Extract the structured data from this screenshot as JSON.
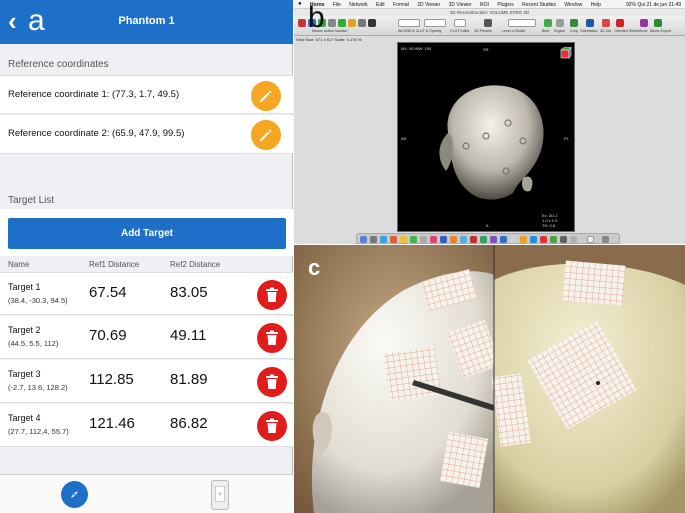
{
  "panel_a": {
    "label": "a",
    "header": {
      "back_icon": "chevron-left-icon",
      "title": "Phantom 1"
    },
    "reference_section": {
      "heading": "Reference coordinates",
      "items": [
        {
          "label": "Reference coordinate 1: (77.3, 1.7, 49.5)"
        },
        {
          "label": "Reference coordinate 2: (65.9, 47.9, 99.5)"
        }
      ],
      "edit_icon": "pencil-icon",
      "edit_color": "#f5a623"
    },
    "target_section": {
      "heading": "Target List",
      "add_button": "Add Target",
      "columns": [
        "Name",
        "Ref1 Distance",
        "Ref2 Distance"
      ],
      "rows": [
        {
          "name": "Target 1",
          "coords": "(38.4, -30.3, 94.5)",
          "ref1": "67.54",
          "ref2": "83.05"
        },
        {
          "name": "Target 2",
          "coords": "(44.5, 5.5, 112)",
          "ref1": "70.69",
          "ref2": "49.11"
        },
        {
          "name": "Target 3",
          "coords": "(-2.7, 13.6, 128.2)",
          "ref1": "112.85",
          "ref2": "81.89"
        },
        {
          "name": "Target 4",
          "coords": "(27.7, 112.4, 55.7)",
          "ref1": "121.46",
          "ref2": "86.82"
        }
      ],
      "delete_icon": "trash-icon",
      "delete_color": "#e21b1b"
    },
    "tabbar": {
      "left_icon": "compass-icon",
      "right_icon": "device-icon"
    },
    "accent_color": "#1e6fc8"
  },
  "panel_b": {
    "label": "b",
    "menubar": {
      "items": [
        "Horos",
        "File",
        "Network",
        "Edit",
        "Format",
        "2D Viewer",
        "3D Viewer",
        "ROI",
        "Plugins",
        "Recent Studies",
        "Window",
        "Help"
      ],
      "clock": "92% Qui 21 de jun 21:49"
    },
    "window_title": "3D Reconstruction: VOLUME STRO 3D",
    "toolbar_labels": [
      "Mouse button function",
      "WL/WW & CLUT & Opacity",
      "CLUT Editor",
      "3D Presets",
      "Level of Detail",
      "Best",
      "Engine",
      "Crop",
      "Orientation",
      "3D Ctrl",
      "Oriented Slider",
      "Movie",
      "Movie Export"
    ],
    "info_line": "View Size: 671 x 617    Scale: 0.178 %",
    "viewer_text": {
      "top_left": "WL: 50 WW: 100",
      "top": "SR",
      "left": "AR",
      "right": "PL",
      "bottom": "IL",
      "bottom_right_1": "Ex: 2D-1",
      "bottom_right_2": "1.0 x 1.0",
      "bottom_right_3": "TH: 0.8"
    }
  },
  "panel_c": {
    "label": "c"
  }
}
